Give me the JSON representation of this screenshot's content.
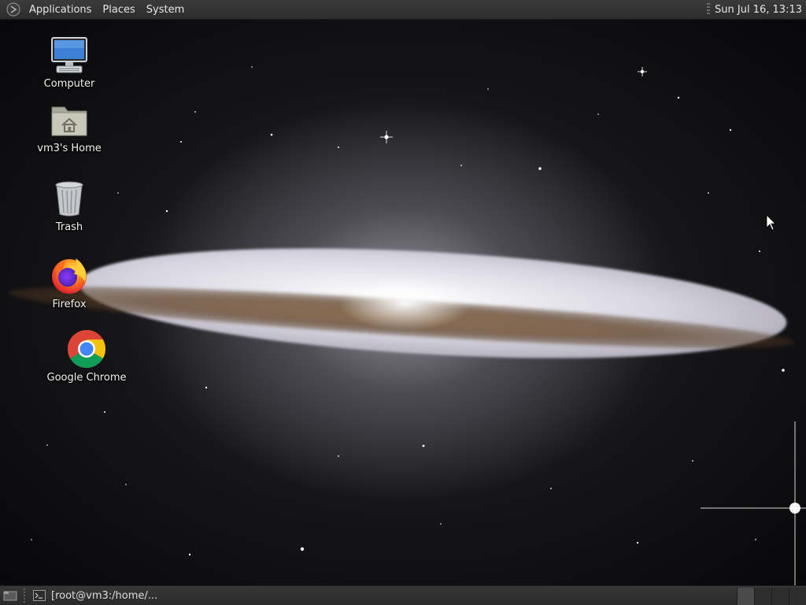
{
  "top_panel": {
    "menus": [
      "Applications",
      "Places",
      "System"
    ],
    "clock": "Sun Jul 16, 13:13"
  },
  "desktop": {
    "icons": [
      {
        "label": "Computer",
        "icon": "computer-icon"
      },
      {
        "label": "vm3's Home",
        "icon": "home-folder-icon"
      },
      {
        "label": "Trash",
        "icon": "trash-icon"
      },
      {
        "label": "Firefox",
        "icon": "firefox-icon"
      },
      {
        "label": "Google Chrome",
        "icon": "chrome-icon"
      }
    ]
  },
  "bottom_panel": {
    "task_label": "[root@vm3:/home/...",
    "workspace_count": 4,
    "active_workspace": 1
  },
  "colors": {
    "panel": "#2c2c2c",
    "panel_text": "#e6e6e6"
  }
}
